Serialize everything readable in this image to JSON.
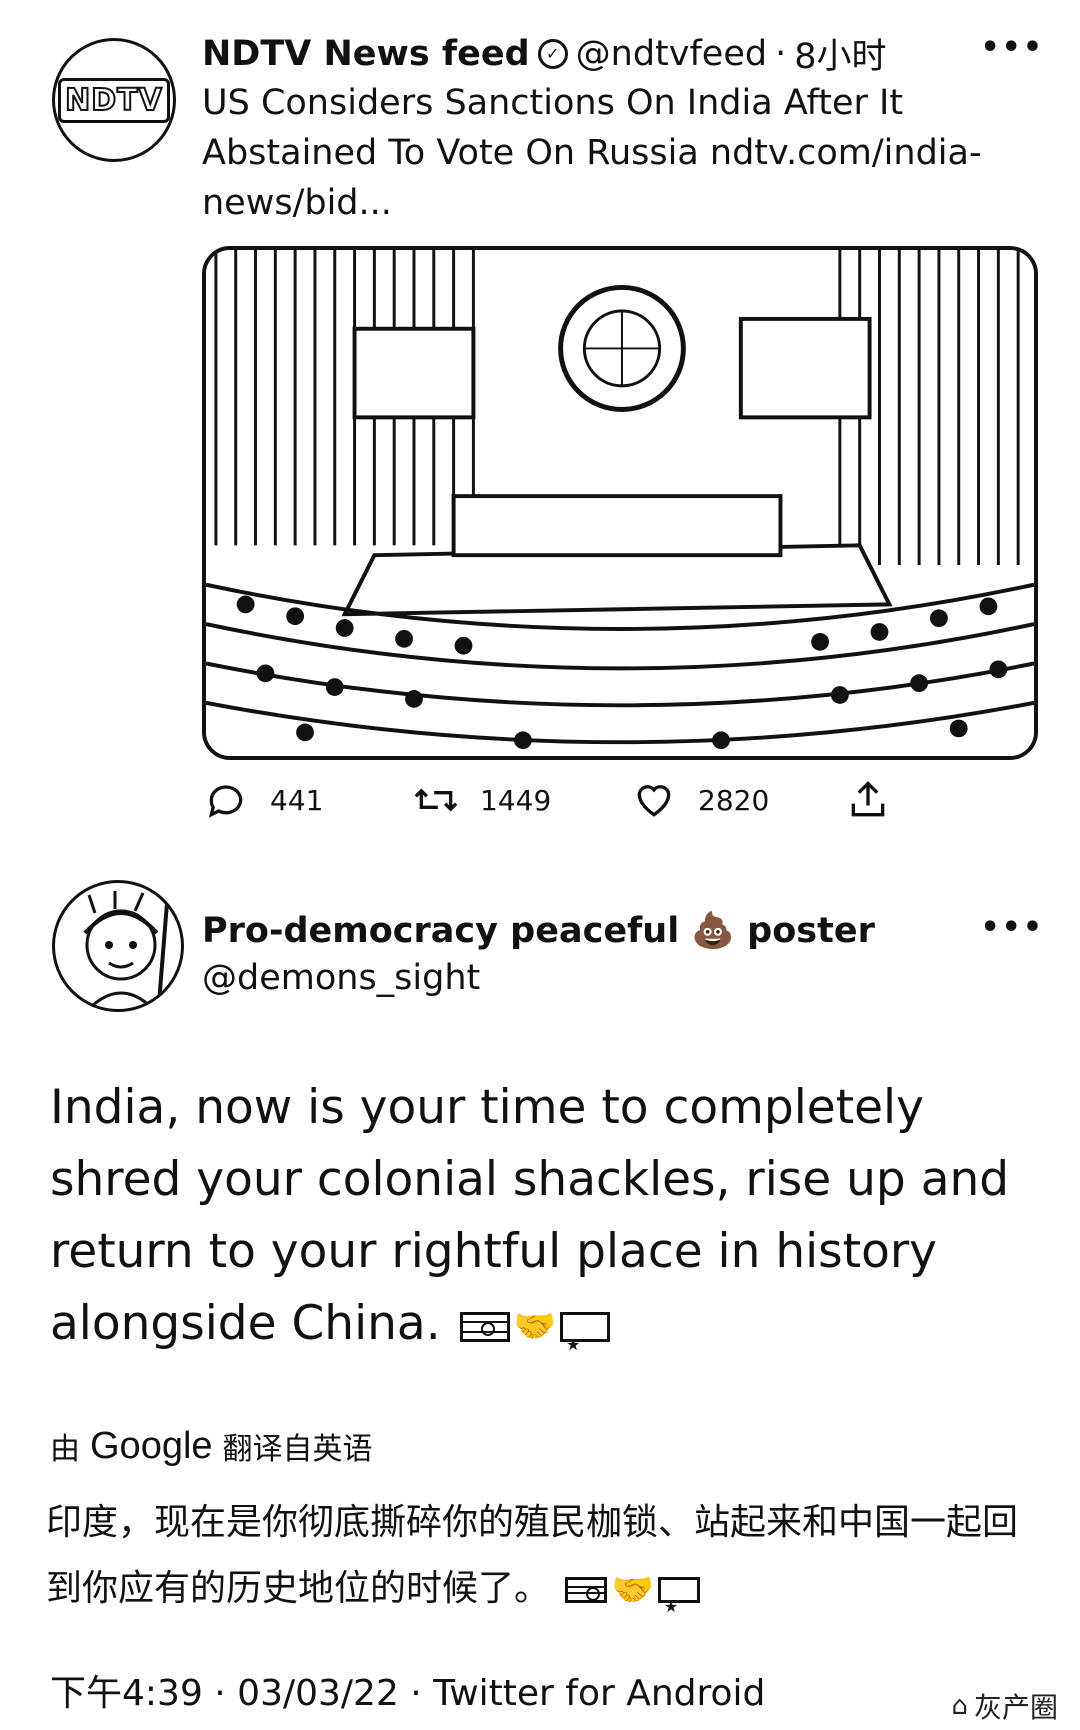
{
  "quoted_tweet": {
    "author_name": "NDTV News feed",
    "verified_icon": "verified-badge-icon",
    "handle": "@ndtvfeed",
    "separator": "·",
    "time": "8小时",
    "more": "•••",
    "avatar_text": "NDTV",
    "text": "US Considers Sanctions On India After It Abstained To Vote On Russia ndtv.com/india-news/bid...",
    "actions": {
      "replies": "441",
      "retweets": "1449",
      "likes": "2820"
    }
  },
  "main_tweet": {
    "author_name_prefix": "Pro-democracy peaceful",
    "author_emoji": "💩",
    "author_name_suffix": "poster",
    "handle": "@demons_sight",
    "more": "•••",
    "text": "India, now is your time to completely shred your colonial shackles, rise up and return to your rightful place in history alongside China.",
    "translated_by_prefix": "由",
    "translated_by_brand": "Google",
    "translated_by_suffix": "翻译自英语",
    "translation": "印度，现在是你彻底撕碎你的殖民枷锁、站起来和中国一起回到你应有的历史地位的时候了。",
    "emoji_handshake": "🤝",
    "timestamp": "下午4:39 · 03/03/22 · Twitter for Android"
  },
  "watermark": {
    "icon": "wechat-icon",
    "text": "灰产圈"
  }
}
